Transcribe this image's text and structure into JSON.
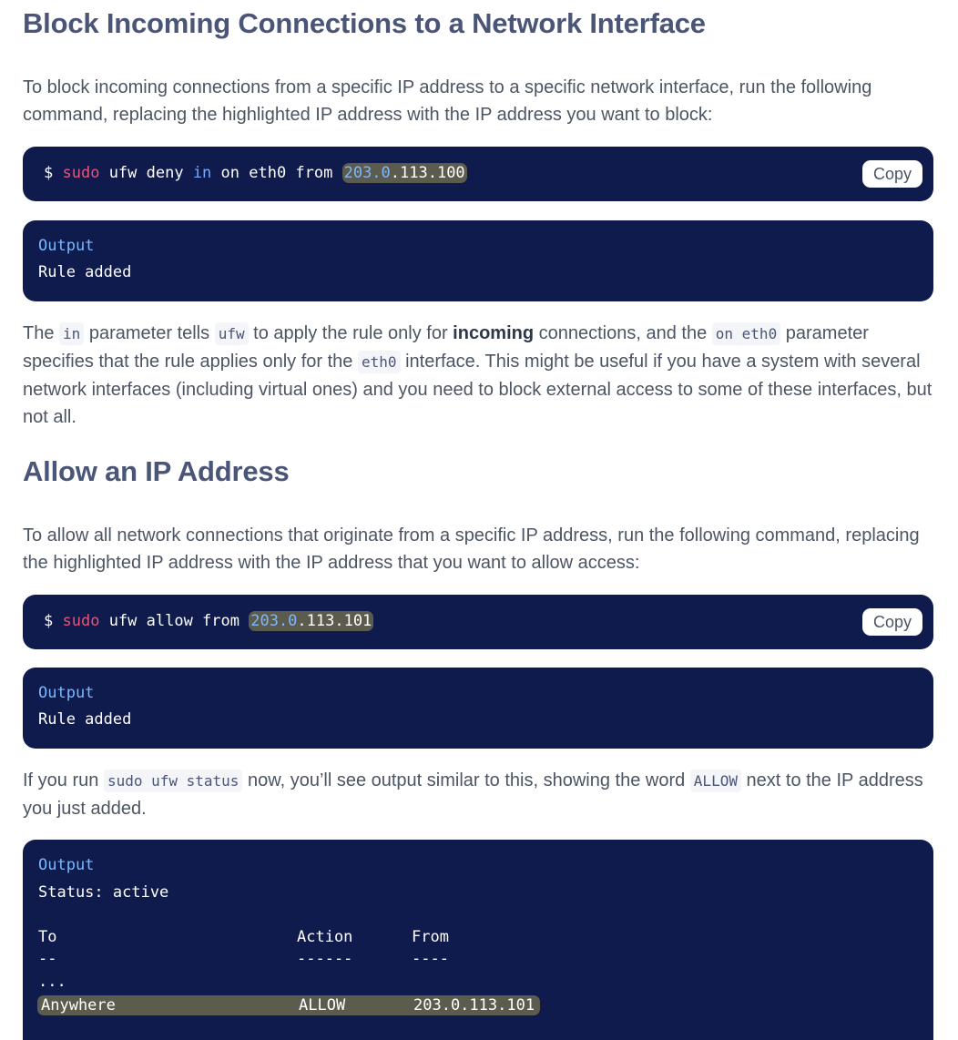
{
  "section1": {
    "heading": "Block Incoming Connections to a Network Interface",
    "intro": "To block incoming connections from a specific IP address to a specific network interface, run the following command, replacing the highlighted IP address with the IP address you want to block:",
    "command": {
      "prompt": "$",
      "sudo": "sudo",
      "part1": " ufw deny ",
      "kw_in": "in",
      "part2": " on eth0 from ",
      "ip_highlight": "203.0",
      "ip_rest": ".113.100",
      "copy_label": "Copy"
    },
    "output": {
      "label": "Output",
      "line1": "Rule added"
    },
    "explain": {
      "t1": "The ",
      "c1": "in",
      "t2": " parameter tells ",
      "c2": "ufw",
      "t3": " to apply the rule only for ",
      "bold": "incoming",
      "t4": " connections, and the ",
      "c3": "on eth0",
      "t5": " parameter specifies that the rule applies only for the ",
      "c4": "eth0",
      "t6": " interface. This might be useful if you have a system with several network interfaces (including virtual ones) and you need to block external access to some of these interfaces, but not all."
    }
  },
  "section2": {
    "heading": "Allow an IP Address",
    "intro": "To allow all network connections that originate from a specific IP address, run the following command, replacing the highlighted IP address with the IP address that you want to allow access:",
    "command": {
      "prompt": "$",
      "sudo": "sudo",
      "part1": " ufw allow from ",
      "ip_highlight": "203.0",
      "ip_rest": ".113.101",
      "copy_label": "Copy"
    },
    "output": {
      "label": "Output",
      "line1": "Rule added"
    },
    "explain": {
      "t1": "If you run ",
      "c1": "sudo ufw status",
      "t2": " now, you’ll see output similar to this, showing the word ",
      "c2": "ALLOW",
      "t3": " next to the IP address you just added."
    },
    "status_output": {
      "label": "Output",
      "status": "Status: active",
      "headers": {
        "to": "To",
        "action": "Action",
        "from": "From"
      },
      "dashes": {
        "to": "--",
        "action": "------",
        "from": "----"
      },
      "ellipsis": "...",
      "row": {
        "to": "Anywhere",
        "action": "ALLOW",
        "from": "203.0.113.101"
      }
    }
  }
}
